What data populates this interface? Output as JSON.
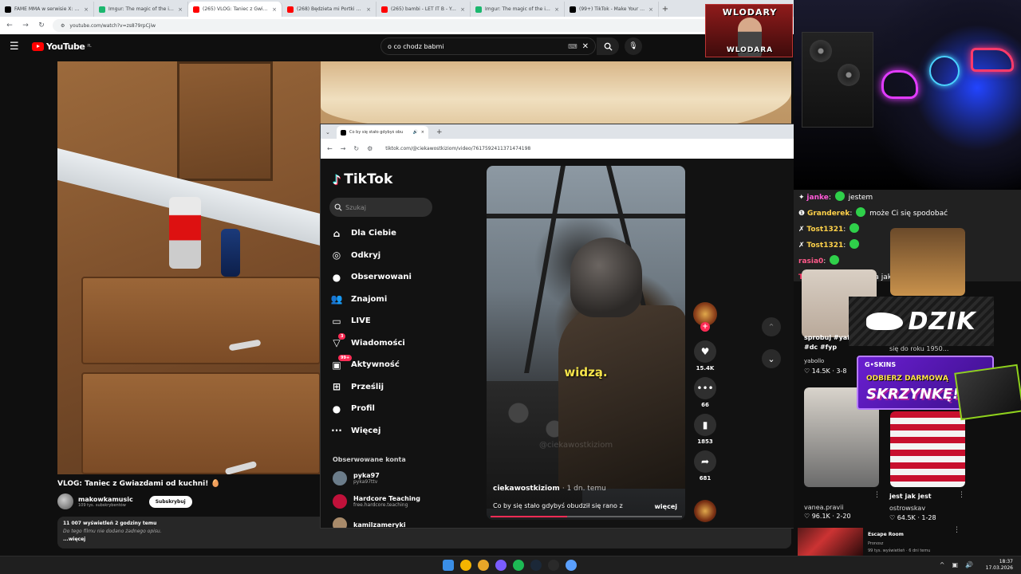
{
  "browser": {
    "tabs": [
      {
        "title": "FAME MMA w serwisie X: „Od p",
        "color": "#000000",
        "active": false
      },
      {
        "title": "Imgur: The magic of the intern",
        "color": "#1bb76e",
        "active": false
      },
      {
        "title": "(265) VLOG: Taniec z Gwiazdam",
        "color": "#ff0000",
        "active": true
      },
      {
        "title": "(268) Będzieta mi Portki Prać | L",
        "color": "#ff0000",
        "active": false
      },
      {
        "title": "(265) bambi - LET IT B - YouTub",
        "color": "#ff0000",
        "active": false
      },
      {
        "title": "Imgur: The magic of the intern",
        "color": "#1bb76e",
        "active": false
      },
      {
        "title": "(99+) TikTok - Make Your Day",
        "color": "#000000",
        "active": false
      }
    ],
    "close_glyph": "×",
    "new_tab_glyph": "+",
    "url": "youtube.com/watch?v=zs879rpCjiw"
  },
  "youtube": {
    "logo_text": "YouTube",
    "logo_region": "PL",
    "search_query": "o co chodz babmi",
    "video_title": "VLOG: Taniec z Gwiazdami od kuchni! 🥚",
    "channel_name": "makowkamusic",
    "channel_subs": "109 tys. subskrybentów",
    "subscribe_label": "Subskrybuj",
    "views_line": "11 007 wyświetleń  2 godziny temu",
    "description": "Do tego filmu nie dodano żadnego opisu.",
    "more_label": "...więcej"
  },
  "tiktok": {
    "tab_title": "Co by się stało gdybyś obu",
    "url": "tiktok.com/@ciekawostkiziom/video/7617592411371474198",
    "logo_text": "TikTok",
    "search_placeholder": "Szukaj",
    "nav": [
      {
        "label": "Dla Ciebie",
        "icon": "⌂"
      },
      {
        "label": "Odkryj",
        "icon": "◎"
      },
      {
        "label": "Obserwowani",
        "icon": "●"
      },
      {
        "label": "Znajomi",
        "icon": "👥"
      },
      {
        "label": "LIVE",
        "icon": "▭"
      },
      {
        "label": "Wiadomości",
        "icon": "▽",
        "badge": "3"
      },
      {
        "label": "Aktywność",
        "icon": "▣",
        "badge": "99+"
      },
      {
        "label": "Prześlij",
        "icon": "⊞"
      },
      {
        "label": "Profil",
        "icon": "●"
      },
      {
        "label": "Więcej",
        "icon": "···"
      }
    ],
    "followed_header": "Obserwowane konta",
    "followed": [
      {
        "name": "pyka97",
        "handle": "pyka97ttv",
        "color": "#6b7c8a"
      },
      {
        "name": "Hardcore Teaching",
        "handle": "free.hardcore.teaching",
        "color": "#c0113a"
      },
      {
        "name": "kamilzameryki",
        "handle": "",
        "color": "#a88a6a"
      }
    ],
    "video": {
      "caption": "widzą.",
      "watermark": "@ciekawostkiziom",
      "author": "ciekawostkiziom",
      "time": "1 dn. temu",
      "description": "Co by się stało gdybyś obudził się rano z",
      "more": "więcej",
      "progress": 0.4
    },
    "actions": [
      {
        "icon": "♥",
        "count": "15.4K"
      },
      {
        "icon": "•••",
        "count": "66"
      },
      {
        "icon": "▮",
        "count": "1853"
      },
      {
        "icon": "➦",
        "count": "681"
      }
    ],
    "follow_plus": "+",
    "arrow_up": "⌃",
    "arrow_down": "⌄"
  },
  "stream": {
    "badge_title": "WLODARY",
    "badge_sub": "WLODARA",
    "chat": [
      {
        "user": "janke",
        "user_color": "#ff5ad8",
        "text": "jestem",
        "icons": "✦"
      },
      {
        "user": "Granderek",
        "user_color": "#ffd24a",
        "text": "może Ci się spodobać",
        "icons": "❶"
      },
      {
        "user": "Tost1321",
        "user_color": "#ffd24a",
        "text": "",
        "icons": "✗"
      },
      {
        "user": "Tost1321",
        "user_color": "#ffd24a",
        "text": "",
        "icons": "✗"
      },
      {
        "user": "rasia0",
        "user_color": "#ff5a8a",
        "text": "",
        "icons": ""
      },
      {
        "user": "TopVPluz",
        "user_color": "#ff3a6a",
        "text": "nołej a jak tak było ?",
        "icons": ""
      }
    ],
    "cards": [
      {
        "caption": "sprobuj #yal #dc #fyp",
        "channel": "yabollo",
        "stats": "♡ 14.5K · 3-8"
      },
      {
        "caption": "się do roku 1950...",
        "channel": "",
        "stats": ""
      },
      {
        "caption": "",
        "channel": "vanea.pravii",
        "stats": "♡ 96.1K · 2-20"
      },
      {
        "caption": "jest jak jest",
        "channel": "ostrowskav",
        "stats": "♡ 64.5K · 1-28"
      }
    ],
    "dzik": "DZIK",
    "promo_brand": "G•SKINS",
    "promo_line1": "ODBIERZ DARMOWĄ",
    "promo_line2": "SKRZYNKĘ!",
    "bottom_title": "Escape Room",
    "bottom_channel": "Pronosz",
    "bottom_meta": "99 tys. wyświetleń · 6 dni temu"
  },
  "taskbar": {
    "time": "18:37",
    "date": "17.03.2026",
    "icon_colors": [
      "#3a8ee6",
      "#f4b400",
      "#e8a628",
      "#7a5cff",
      "#1db954",
      "#1b2838",
      "#2a2a2a",
      "#5aa0ff"
    ]
  }
}
